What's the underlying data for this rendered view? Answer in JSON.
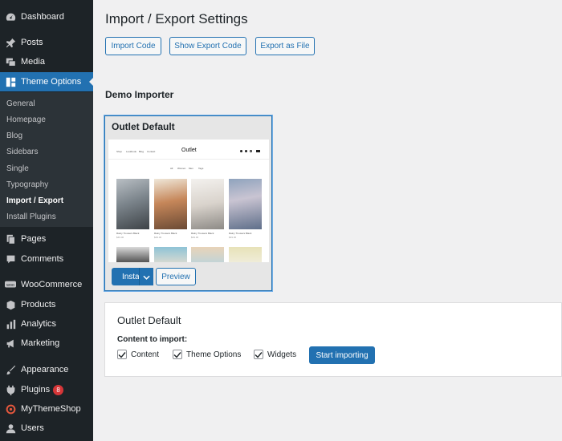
{
  "sidebar": {
    "items": [
      {
        "label": "Dashboard",
        "icon": "dashboard-icon"
      },
      {
        "label": "Posts",
        "icon": "pin-icon"
      },
      {
        "label": "Media",
        "icon": "media-icon"
      },
      {
        "label": "Theme Options",
        "icon": "grid-icon"
      },
      {
        "label": "Pages",
        "icon": "pages-icon"
      },
      {
        "label": "Comments",
        "icon": "comment-icon"
      },
      {
        "label": "WooCommerce",
        "icon": "woo-icon"
      },
      {
        "label": "Products",
        "icon": "box-icon"
      },
      {
        "label": "Analytics",
        "icon": "bar-chart-icon"
      },
      {
        "label": "Marketing",
        "icon": "megaphone-icon"
      },
      {
        "label": "Appearance",
        "icon": "brush-icon"
      },
      {
        "label": "Plugins",
        "icon": "plug-icon",
        "badge": "8"
      },
      {
        "label": "MyThemeShop",
        "icon": "mts-icon"
      },
      {
        "label": "Users",
        "icon": "user-icon"
      }
    ],
    "submenu": [
      "General",
      "Homepage",
      "Blog",
      "Sidebars",
      "Single",
      "Typography",
      "Import / Export",
      "Install Plugins"
    ]
  },
  "page": {
    "title": "Import / Export Settings",
    "buttons": {
      "import_code": "Import Code",
      "show_export": "Show Export Code",
      "export_file": "Export as File"
    },
    "demo_section_title": "Demo Importer"
  },
  "demo": {
    "title": "Outlet Default",
    "install_label": "Install",
    "preview_label": "Preview",
    "preview": {
      "logo": "Outlet",
      "nav": [
        "Shop",
        "Lookbook",
        "Blog",
        "Contact"
      ],
      "tabs": [
        "All",
        "Women",
        "Men",
        "Tags"
      ],
      "products": [
        "Rainy Trousers Black",
        "Rainy Trousers Black",
        "Rainy Trousers Black",
        "Rainy Trousers Black"
      ],
      "price": "$49.00"
    }
  },
  "import_panel": {
    "title": "Outlet Default",
    "label": "Content to import:",
    "options": [
      "Content",
      "Theme Options",
      "Widgets"
    ],
    "start_label": "Start importing"
  },
  "colors": {
    "accent": "#2271b1",
    "sidebar": "#1d2327",
    "submenu": "#2c3338",
    "badge": "#d63638"
  }
}
